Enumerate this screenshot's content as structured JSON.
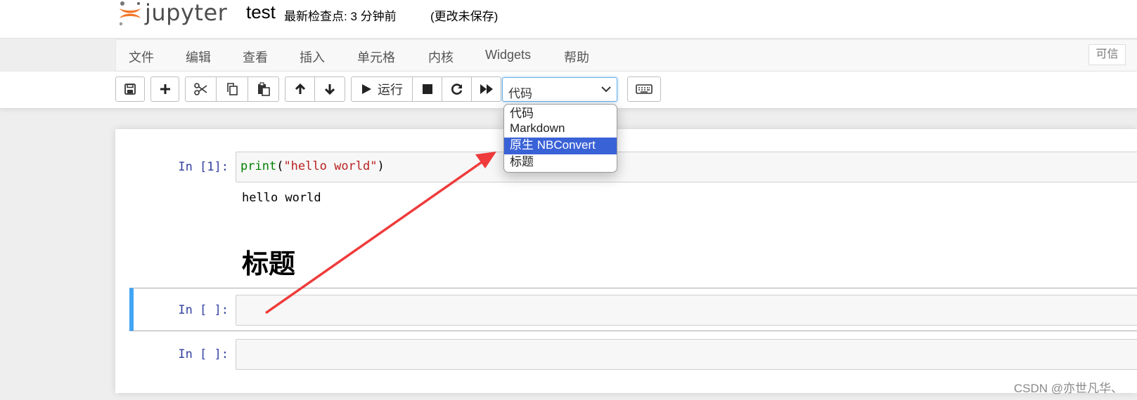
{
  "header": {
    "logo_text": "jupyter",
    "notebook_title": "test",
    "checkpoint": "最新检查点: 3 分钟前",
    "autosave": "(更改未保存)"
  },
  "menu": {
    "items": [
      "文件",
      "编辑",
      "查看",
      "插入",
      "单元格",
      "内核",
      "Widgets",
      "帮助"
    ],
    "trusted": "可信"
  },
  "toolbar": {
    "run_label": "运行",
    "cell_type": {
      "selected": "代码",
      "options": [
        "代码",
        "Markdown",
        "原生 NBConvert",
        "标题"
      ],
      "highlighted": "原生 NBConvert"
    },
    "icons": [
      "save-icon",
      "plus-icon",
      "scissors-icon",
      "copy-icon",
      "paste-icon",
      "arrow-up-icon",
      "arrow-down-icon",
      "play-icon",
      "stop-icon",
      "restart-icon",
      "fast-forward-icon",
      "keyboard-icon"
    ]
  },
  "cells": [
    {
      "prompt": "In  [1]:",
      "code_fn": "print",
      "code_paren_open": "(",
      "code_str": "\"hello world\"",
      "code_paren_close": ")",
      "output": "hello world"
    },
    {
      "heading": "标题"
    },
    {
      "prompt": "In  [ ]:"
    },
    {
      "prompt": "In  [ ]:"
    }
  ],
  "colors": {
    "accent_selected": "#42a5f5",
    "dropdown_highlight": "#3a62d7",
    "annotation_arrow": "#ef3b3b",
    "logo_orange": "#f37626"
  },
  "watermark": "CSDN @亦世凡华、"
}
